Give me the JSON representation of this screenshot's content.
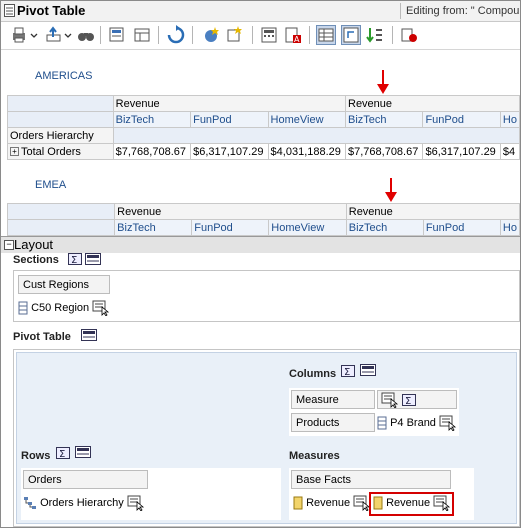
{
  "window": {
    "title": "Pivot Table",
    "editing_from": "Editing from: \" Compou"
  },
  "preview": {
    "sections": [
      {
        "title": "AMERICAS",
        "measure_header": [
          "Revenue",
          "Revenue"
        ],
        "brands": [
          "BizTech",
          "FunPod",
          "HomeView",
          "BizTech",
          "FunPod",
          "Ho"
        ],
        "row_header": "Orders Hierarchy",
        "total_label": "Total Orders",
        "values": [
          "$7,768,708.67",
          "$6,317,107.29",
          "$4,031,188.29",
          "$7,768,708.67",
          "$6,317,107.29",
          "$4"
        ]
      },
      {
        "title": "EMEA",
        "measure_header": [
          "Revenue",
          "Revenue"
        ],
        "brands": [
          "BizTech",
          "FunPod",
          "HomeView",
          "BizTech",
          "FunPod",
          "Ho"
        ]
      }
    ]
  },
  "layout": {
    "title": "Layout",
    "sections": {
      "label": "Sections",
      "drop_label": "Cust Regions",
      "item": "C50 Region"
    },
    "pivot": {
      "label": "Pivot Table",
      "columns": {
        "label": "Columns",
        "measure_labels": "Measure Labels",
        "products": "Products",
        "item": "P4 Brand"
      },
      "rows": {
        "label": "Rows",
        "drop_label": "Orders",
        "item": "Orders Hierarchy"
      },
      "measures": {
        "label": "Measures",
        "drop_label": "Base Facts",
        "items": [
          "Revenue",
          "Revenue"
        ]
      }
    }
  },
  "colors": {
    "highlight": "#d40000",
    "member_text": "#1f4e8c",
    "arrow": "#e00000"
  },
  "icons": [
    "pivot-table-icon",
    "print-icon",
    "export-icon",
    "binoculars-icon",
    "properties-icon",
    "refresh-icon",
    "new-calc-icon",
    "sigma-icon",
    "sort-icon",
    "pivot-view-icon"
  ]
}
